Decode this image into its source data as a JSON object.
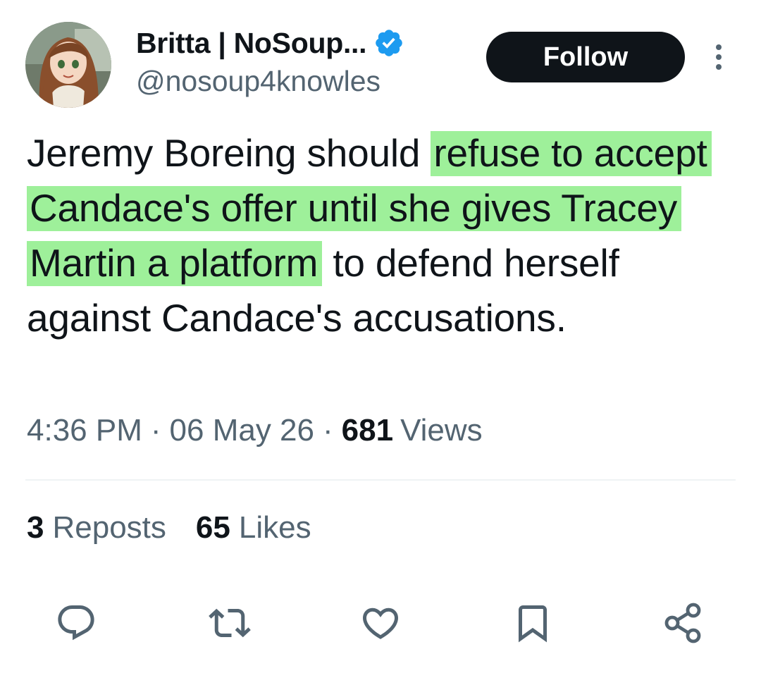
{
  "author": {
    "display_name": "Britta | NoSoup...",
    "handle": "@nosoup4knowles",
    "verified": true
  },
  "header": {
    "follow_label": "Follow"
  },
  "tweet": {
    "text_before": "Jeremy Boreing should ",
    "text_highlighted": "refuse to accept Candace's offer until she gives Tracey Martin a platform",
    "text_after": " to defend herself against Candace's accusations.",
    "highlight_color": "#9ef09a"
  },
  "meta": {
    "time": "4:36 PM",
    "separator": "·",
    "date": "06 May 26",
    "views_count": "681",
    "views_label": "Views"
  },
  "stats": {
    "reposts_count": "3",
    "reposts_label": "Reposts",
    "likes_count": "65",
    "likes_label": "Likes"
  },
  "actions": {
    "icons": [
      "reply-icon",
      "repost-icon",
      "like-icon",
      "bookmark-icon",
      "share-icon"
    ]
  },
  "colors": {
    "text_primary": "#0f1419",
    "text_secondary": "#536471",
    "verified_blue": "#1d9bf0",
    "divider": "#eff3f4"
  }
}
